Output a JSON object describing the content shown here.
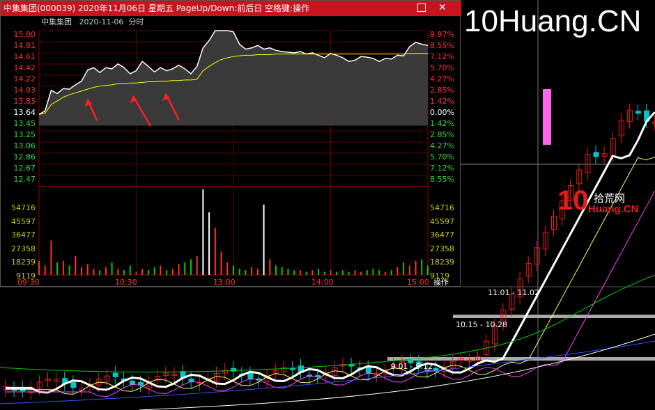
{
  "window": {
    "title": "中集集团(000039) 2020年11月06日 星期五 PageUp/Down:前后日 空格键:操作",
    "header_name": "中集集团",
    "header_date": "2020-11-06",
    "header_mode": "分时",
    "operate_label": "操作"
  },
  "watermark": "10Huang.CN",
  "logo": {
    "num": "10",
    "text": "拾荒网",
    "sub": "Huang.CN"
  },
  "price_labels_left": [
    "15.00",
    "14.81",
    "14.61",
    "14.42",
    "14.22",
    "14.03",
    "13.83",
    "13.64",
    "13.45",
    "13.25",
    "13.06",
    "12.86",
    "12.67",
    "12.47"
  ],
  "pct_labels_right": [
    "9.97%",
    "8.55%",
    "7.12%",
    "5.70%",
    "4.27%",
    "2.85%",
    "1.42%",
    "0.00%",
    "1.42%",
    "2.85%",
    "4.27%",
    "5.70%",
    "7.12%",
    "8.55%"
  ],
  "vol_labels": [
    "54716",
    "45597",
    "36477",
    "27358",
    "18239",
    "9119"
  ],
  "time_labels": [
    "09:30",
    "10:30",
    "13:00",
    "14:00",
    "15:00"
  ],
  "range_labels": [
    "11.01 - 11.02",
    "10.15 - 10.28",
    "9.01 - 9.12"
  ],
  "colors": {
    "title_bar": "#c8141e",
    "up": "#e81c1c",
    "down": "#00c8c8",
    "price_line": "#ffffff",
    "avg_line": "#ffff00",
    "grid": "#8b0000"
  },
  "chart_data": [
    {
      "type": "line",
      "title": "中集集团 2020-11-06 分时",
      "x_ticks": [
        "09:30",
        "10:30",
        "13:00",
        "14:00",
        "15:00"
      ],
      "ylim": [
        12.47,
        15.0
      ],
      "prev_close": 13.64,
      "series": [
        {
          "name": "price",
          "values": [
            13.64,
            13.7,
            14.03,
            13.98,
            14.06,
            14.05,
            14.12,
            14.18,
            14.36,
            14.4,
            14.32,
            14.4,
            14.38,
            14.46,
            14.4,
            14.3,
            14.35,
            14.5,
            14.42,
            14.33,
            14.4,
            14.35,
            14.38,
            14.44,
            14.38,
            14.3,
            14.42,
            14.72,
            14.84,
            15.0,
            15.0,
            15.0,
            14.98,
            14.78,
            14.7,
            14.72,
            14.76,
            14.7,
            14.72,
            14.68,
            14.66,
            14.65,
            14.64,
            14.66,
            14.62,
            14.64,
            14.6,
            14.56,
            14.63,
            14.6,
            14.56,
            14.5,
            14.52,
            14.58,
            14.57,
            14.55,
            14.5,
            14.55,
            14.54,
            14.6,
            14.59,
            14.74,
            14.81,
            14.78,
            14.76
          ]
        },
        {
          "name": "avg",
          "values": [
            13.64,
            13.66,
            13.8,
            13.86,
            13.92,
            13.96,
            13.99,
            14.02,
            14.05,
            14.08,
            14.1,
            14.11,
            14.12,
            14.14,
            14.14,
            14.15,
            14.15,
            14.16,
            14.17,
            14.17,
            14.18,
            14.18,
            14.19,
            14.19,
            14.2,
            14.2,
            14.21,
            14.35,
            14.42,
            14.48,
            14.53,
            14.56,
            14.58,
            14.59,
            14.6,
            14.6,
            14.61,
            14.61,
            14.61,
            14.62,
            14.62,
            14.62,
            14.62,
            14.62,
            14.62,
            14.62,
            14.62,
            14.62,
            14.62,
            14.62,
            14.62,
            14.62,
            14.62,
            14.62,
            14.62,
            14.62,
            14.62,
            14.62,
            14.62,
            14.62,
            14.62,
            14.63,
            14.63,
            14.63,
            14.63
          ]
        }
      ]
    },
    {
      "type": "bar",
      "title": "volume",
      "ylim": [
        0,
        54716
      ],
      "values": [
        9000,
        6000,
        22000,
        8000,
        9000,
        6000,
        12000,
        5000,
        7000,
        4000,
        3000,
        5000,
        8000,
        4000,
        3000,
        6000,
        2000,
        4000,
        3000,
        5000,
        6000,
        3000,
        4000,
        7000,
        8000,
        10000,
        12000,
        54716,
        40000,
        30000,
        15000,
        8000,
        6000,
        4000,
        3000,
        5000,
        4000,
        45000,
        10000,
        6000,
        5000,
        4000,
        3000,
        3000,
        2000,
        3000,
        4000,
        2000,
        3000,
        2000,
        3000,
        2000,
        3000,
        2000,
        3000,
        4000,
        3000,
        2000,
        3000,
        5000,
        8000,
        6000,
        9000,
        10000,
        6000
      ]
    }
  ]
}
